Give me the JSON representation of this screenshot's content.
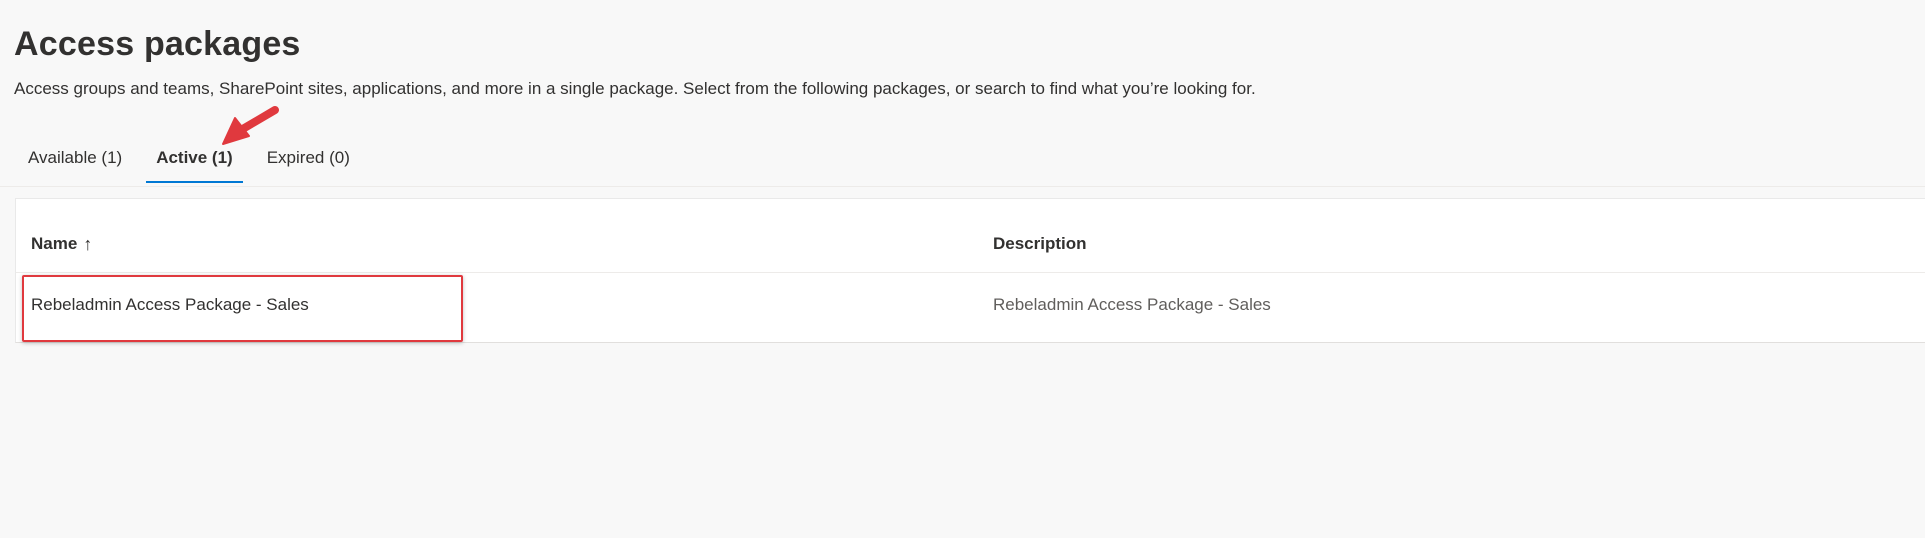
{
  "page": {
    "title": "Access packages",
    "subtitle": "Access groups and teams, SharePoint sites, applications, and more in a single package. Select from the following packages, or search to find what you’re looking for."
  },
  "tabs": [
    {
      "label": "Available (1)",
      "selected": false
    },
    {
      "label": "Active (1)",
      "selected": true
    },
    {
      "label": "Expired (0)",
      "selected": false
    }
  ],
  "table": {
    "columns": [
      {
        "label": "Name",
        "sort": "ascending",
        "sort_icon": "↑"
      },
      {
        "label": "Description"
      }
    ],
    "rows": [
      {
        "name": "Rebeladmin Access Package - Sales",
        "description": "Rebeladmin Access Package - Sales"
      }
    ]
  },
  "annotations": {
    "arrow_color": "#e0393e",
    "highlight_color": "#e0393e"
  },
  "colors": {
    "accent": "#0078d4",
    "background": "#f8f8f8"
  }
}
